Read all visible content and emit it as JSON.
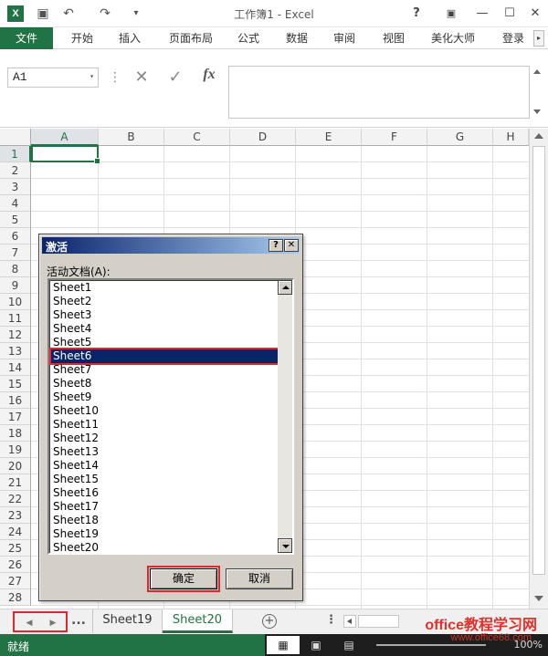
{
  "app": {
    "window_title": "工作簿1 - Excel",
    "logo_text": "X"
  },
  "quick_access": [
    {
      "name": "save-icon",
      "glyph": "▣"
    },
    {
      "name": "undo-icon",
      "glyph": "↶"
    },
    {
      "name": "redo-icon",
      "glyph": "↷"
    },
    {
      "name": "customize-icon",
      "glyph": "▾"
    }
  ],
  "window_controls": {
    "help": "?",
    "ribbon_options": "▣",
    "minimize": "—",
    "maximize": "☐",
    "close": "✕"
  },
  "ribbon": {
    "tabs": [
      "文件",
      "开始",
      "插入",
      "页面布局",
      "公式",
      "数据",
      "审阅",
      "视图",
      "美化大师",
      "登录"
    ],
    "scroll_glyph": "▸"
  },
  "formula_bar": {
    "name_box": "A1",
    "name_box_arrow": "▾",
    "separator": "⋮",
    "cancel_glyph": "✕",
    "enter_glyph": "✓",
    "fx_label": "fx",
    "value": ""
  },
  "grid": {
    "columns": [
      "A",
      "B",
      "C",
      "D",
      "E",
      "F",
      "G",
      "H"
    ],
    "rows": [
      "1",
      "2",
      "3",
      "4",
      "5",
      "6",
      "7",
      "8",
      "9",
      "10",
      "11",
      "12",
      "13",
      "14",
      "15",
      "16",
      "17",
      "18",
      "19",
      "20",
      "21",
      "22",
      "23",
      "24",
      "25",
      "26",
      "27",
      "28"
    ],
    "active_cell": "A1"
  },
  "sheet_tabs": {
    "nav_prev": "◀",
    "nav_next": "▶",
    "more_left": "...",
    "tabs": [
      "Sheet19",
      "Sheet20"
    ],
    "active_tab": "Sheet20",
    "add_glyph": "+",
    "more_right": "⋮"
  },
  "status_bar": {
    "status": "就绪",
    "views": [
      "▦",
      "▣",
      "▤"
    ],
    "zoom": "100%"
  },
  "watermark": {
    "line1": "office教程学习网",
    "line2": "www.office68.com"
  },
  "dialog": {
    "title": "激活",
    "help_glyph": "?",
    "close_glyph": "✕",
    "label": "活动文档(A):",
    "items": [
      "Sheet1",
      "Sheet2",
      "Sheet3",
      "Sheet4",
      "Sheet5",
      "Sheet6",
      "Sheet7",
      "Sheet8",
      "Sheet9",
      "Sheet10",
      "Sheet11",
      "Sheet12",
      "Sheet13",
      "Sheet14",
      "Sheet15",
      "Sheet16",
      "Sheet17",
      "Sheet18",
      "Sheet19",
      "Sheet20"
    ],
    "selected_item": "Sheet6",
    "ok_label": "确定",
    "cancel_label": "取消"
  },
  "colors": {
    "excel_green": "#217346",
    "highlight_red": "#e2252e",
    "selection_navy": "#0a246a"
  }
}
